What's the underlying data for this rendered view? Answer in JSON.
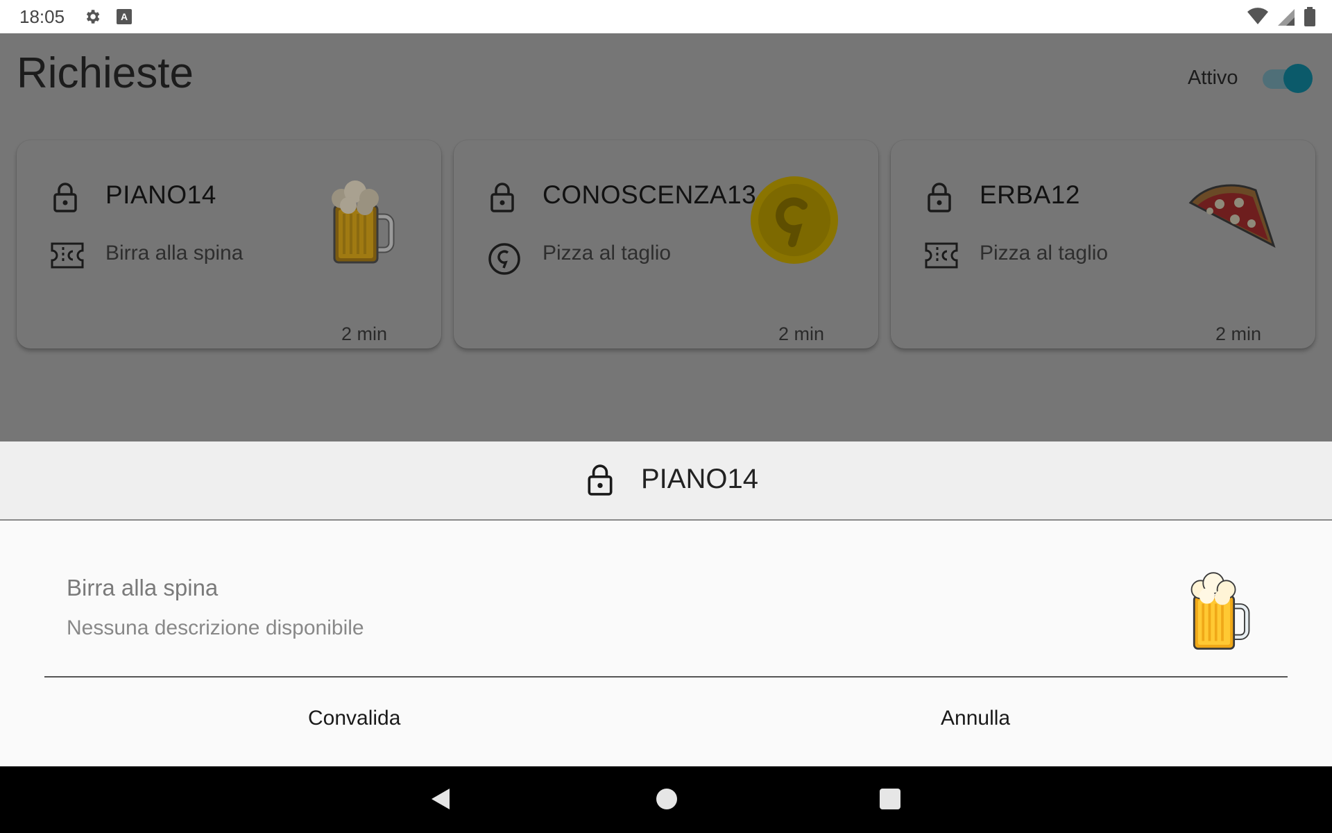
{
  "status_bar": {
    "time": "18:05",
    "icons": [
      "settings-icon",
      "a-notification-icon",
      "wifi-icon",
      "signal-icon",
      "battery-icon"
    ]
  },
  "header": {
    "title": "Richieste",
    "toggle_label": "Attivo",
    "toggle_on": true
  },
  "requests": [
    {
      "code": "PIANO14",
      "type_icon": "ticket-icon",
      "product": "Birra alla spina",
      "time": "2 min",
      "image": "beer-mug"
    },
    {
      "code": "CONOSCENZA13",
      "type_icon": "coin-icon",
      "product": "Pizza al taglio",
      "time": "2 min",
      "image": "gold-coin"
    },
    {
      "code": "ERBA12",
      "type_icon": "ticket-icon",
      "product": "Pizza al taglio",
      "time": "2 min",
      "image": "pizza-slice"
    }
  ],
  "sheet": {
    "code": "PIANO14",
    "product": "Birra alla spina",
    "description": "Nessuna descrizione disponibile",
    "confirm_label": "Convalida",
    "cancel_label": "Annulla"
  },
  "colors": {
    "toggle_knob": "#0b5a6a",
    "coin": "#c9a300",
    "scrim": "#767676"
  }
}
